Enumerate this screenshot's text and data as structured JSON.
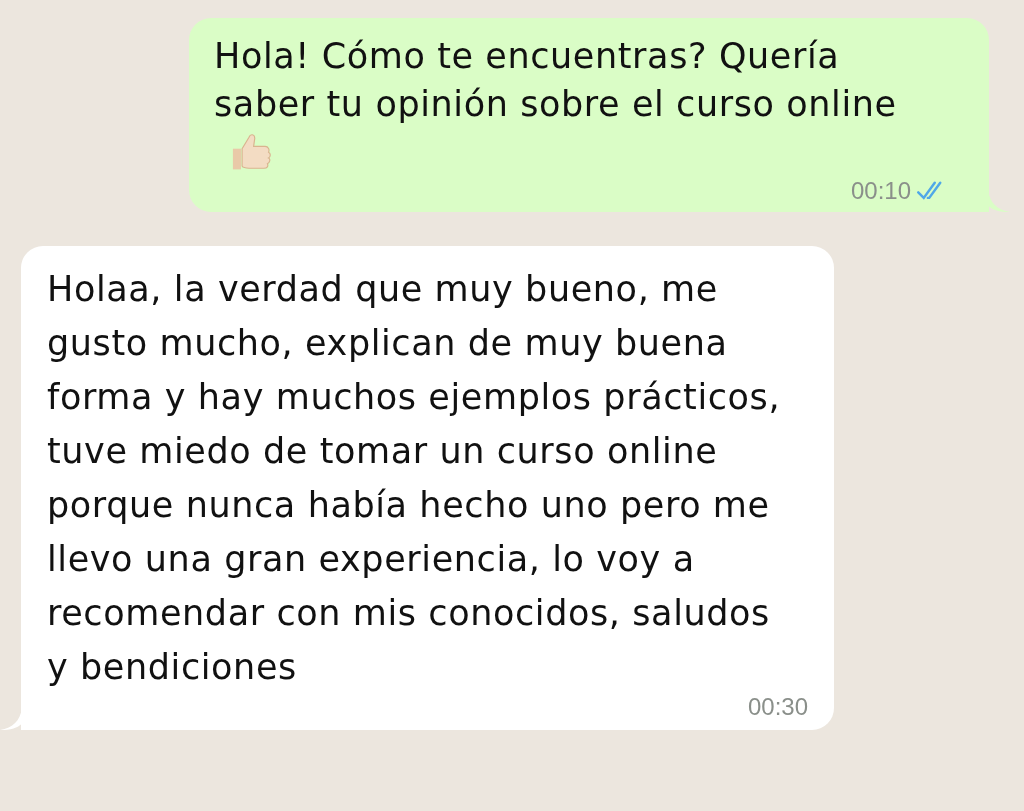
{
  "messages": [
    {
      "kind": "outgoing",
      "text": "Hola! Cómo te encuentras? Quería saber tu opinión sobre el curso online",
      "thumbs_up": true,
      "time": "00:10",
      "read": true
    },
    {
      "kind": "incoming",
      "text": "Holaa, la verdad que muy bueno, me gusto mucho, explican de muy buena forma y hay muchos ejemplos prácticos, tuve miedo de tomar un curso online porque nunca había hecho uno pero me llevo una gran experiencia, lo voy a recomendar con mis conocidos, saludos y bendiciones",
      "time": "00:30"
    }
  ]
}
